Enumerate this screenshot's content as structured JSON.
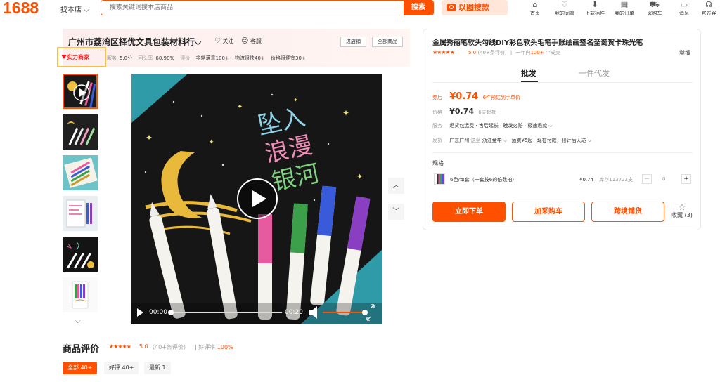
{
  "header": {
    "logo": "1688",
    "find_shop": "找本店 ⌵",
    "search_placeholder": "搜索关键词搜本店商品",
    "search_button": "搜索",
    "image_search": "以图搜款",
    "nav": [
      {
        "label": "首页",
        "icon": "home-icon",
        "glyph": "⌂"
      },
      {
        "label": "我的同盟",
        "icon": "heart-shield-icon",
        "glyph": "♡"
      },
      {
        "label": "下载插件",
        "icon": "download-icon",
        "glyph": "⬇"
      },
      {
        "label": "我的订单",
        "icon": "order-icon",
        "glyph": "▤"
      },
      {
        "label": "采购车",
        "icon": "cart-icon",
        "glyph": "⛟"
      },
      {
        "label": "消息",
        "icon": "message-icon",
        "glyph": "▭"
      },
      {
        "label": "官方客",
        "icon": "headset-icon",
        "glyph": "☊"
      }
    ]
  },
  "shop": {
    "name": "广州市荔湾区择优文具包装材料行⌵",
    "follow": "关注",
    "service": "客服",
    "enter_shop": "进店铺",
    "all_products": "全部商品",
    "power_tag": "实力商家",
    "metrics": {
      "service_label": "服务",
      "service_score": "5.0分",
      "repurchase_label": "回头率",
      "repurchase_value": "60.90%",
      "eval_label": "评价",
      "tags": [
        "非常满意100+",
        "物流很快40+",
        "价格很便宜30+"
      ]
    }
  },
  "gallery": {
    "thumbnails": [
      "视频",
      "图2",
      "图3",
      "图4",
      "图5",
      "图6"
    ],
    "main_image_text": [
      "坠入",
      "浪漫",
      "银河"
    ],
    "video_time_current": "00:00",
    "video_time_total": "00:20",
    "prev_label": "︿",
    "next_label": "﹀"
  },
  "product": {
    "title": "金属秀丽笔软头勾线DIY彩色软头毛笔手账绘画签名圣诞贺卡珠光笔",
    "stars": "★★★★★",
    "rating": "5.0",
    "reviews": "(40+条评价)",
    "sales_prefix": "一年内",
    "sales_value": "100+",
    "sales_suffix": "个成交",
    "report": "举报",
    "tabs": [
      "批发",
      "一件代发"
    ],
    "coupon_label": "券后",
    "coupon_price": "¥0.74",
    "coupon_note": "6件预估到手单价",
    "price_label": "价格",
    "price": "¥0.74",
    "moq": "6支起批",
    "service_label": "服务",
    "services": "退货包运费 · 售后延长 · 晚发必赔 · 极速退款 ⌵",
    "ship_label": "发货",
    "ship_from": "广东广州",
    "ship_to_word": "送至",
    "ship_to": "浙江金华 ⌵",
    "ship_fee": "运费¥5起",
    "ship_time": "现在付款，预计后天达 ⌵",
    "spec_label": "规格",
    "spec_name": "6色/每套（一套按6的倍数拍）",
    "spec_price": "¥0.74",
    "spec_stock": "库存113722支",
    "qty_minus": "−",
    "qty_value": "0",
    "qty_plus": "+",
    "buy_now": "立即下单",
    "add_cart": "加采购车",
    "cross_border": "跨境铺货",
    "collect": "收藏",
    "collect_count": "(3)"
  },
  "reviews_section": {
    "title": "商品评价",
    "stars": "★★★★★",
    "score": "5.0",
    "count": "（40+条评价）",
    "good_rate_label": "| 好评率",
    "good_rate": "100%",
    "tabs": [
      "全部 40+",
      "好评 40+",
      "最新 1"
    ]
  }
}
